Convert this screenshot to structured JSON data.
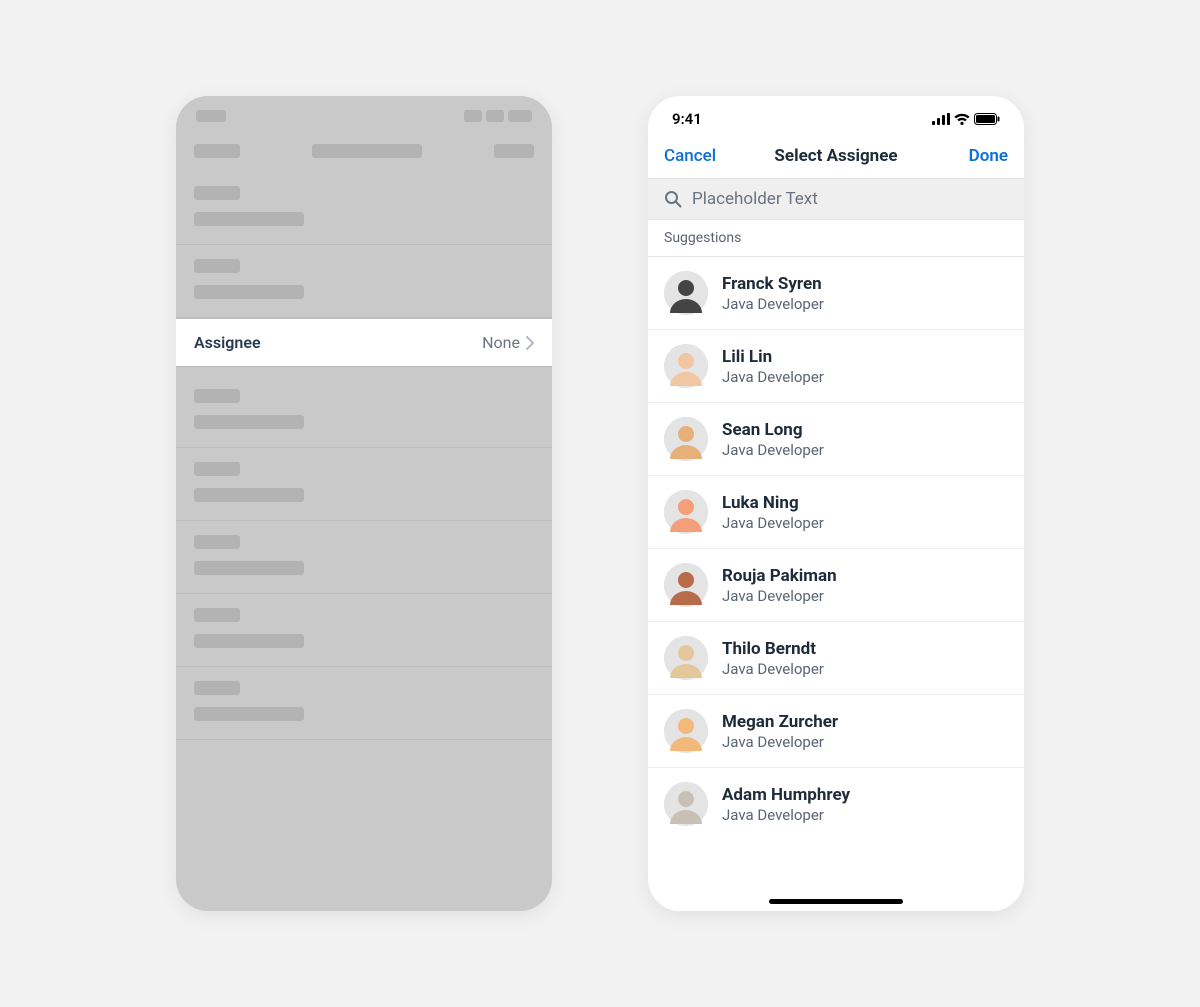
{
  "left": {
    "assignee_label": "Assignee",
    "assignee_value": "None"
  },
  "right": {
    "statusbar": {
      "time": "9:41"
    },
    "header": {
      "cancel": "Cancel",
      "title": "Select Assignee",
      "done": "Done"
    },
    "search": {
      "placeholder": "Placeholder Text"
    },
    "section_label": "Suggestions",
    "suggestions": [
      {
        "name": "Franck Syren",
        "role": "Java Developer"
      },
      {
        "name": "Lili Lin",
        "role": "Java Developer"
      },
      {
        "name": "Sean Long",
        "role": "Java Developer"
      },
      {
        "name": "Luka Ning",
        "role": "Java Developer"
      },
      {
        "name": "Rouja Pakiman",
        "role": "Java Developer"
      },
      {
        "name": "Thilo Berndt",
        "role": "Java Developer"
      },
      {
        "name": "Megan Zurcher",
        "role": "Java Developer"
      },
      {
        "name": "Adam Humphrey",
        "role": "Java Developer"
      }
    ]
  }
}
